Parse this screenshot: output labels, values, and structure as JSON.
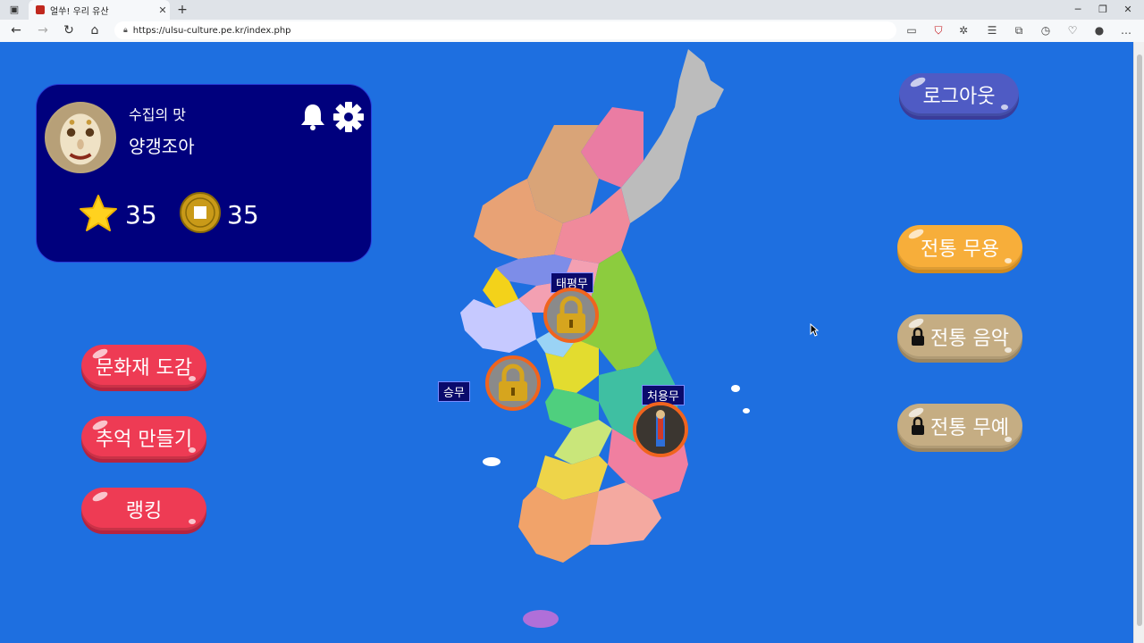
{
  "browser": {
    "tab_title": "얼쑤! 우리 유산",
    "url": "https://ulsu-culture.pe.kr/index.php"
  },
  "profile": {
    "title": "수집의 맛",
    "nickname": "양갱조아",
    "stars": "35",
    "coins": "35"
  },
  "map_pins": [
    {
      "label": "태평무",
      "locked": true
    },
    {
      "label": "승무",
      "locked": true
    },
    {
      "label": "처용무",
      "locked": false
    }
  ],
  "left_menu": {
    "heritage_book": "문화재 도감",
    "memory": "추억 만들기",
    "ranking": "랭킹"
  },
  "right_menu": {
    "logout": "로그아웃",
    "dance": "전통 무용",
    "music": "전통 음악",
    "martial": "전통 무예"
  },
  "colors": {
    "page_bg": "#1e6fe0",
    "profile_bg": "#00007d",
    "red_button": "#ee3b54",
    "blue_button": "#4f5bc4",
    "orange_button": "#f7ae3a",
    "locked_button": "#c5ad83"
  }
}
